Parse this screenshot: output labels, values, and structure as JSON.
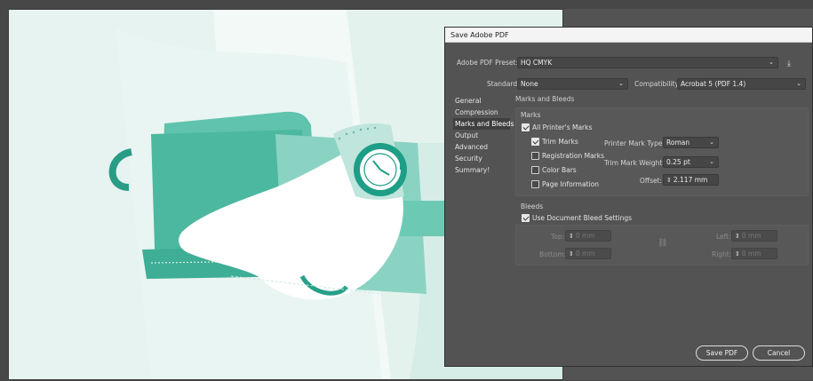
{
  "dialog": {
    "title": "Save Adobe PDF",
    "preset_label": "Adobe PDF Preset:",
    "preset_value": "HQ CMYK",
    "standard_label": "Standard:",
    "standard_value": "None",
    "compat_label": "Compatibility:",
    "compat_value": "Acrobat 5 (PDF 1.4)"
  },
  "sidebar": {
    "items": [
      {
        "label": "General"
      },
      {
        "label": "Compression"
      },
      {
        "label": "Marks and Bleeds"
      },
      {
        "label": "Output"
      },
      {
        "label": "Advanced"
      },
      {
        "label": "Security"
      },
      {
        "label": "Summary!"
      }
    ],
    "selected_index": 2
  },
  "content": {
    "section_title": "Marks and Bleeds",
    "marks": {
      "group_label": "Marks",
      "all_printers_marks": {
        "label": "All Printer's Marks",
        "checked": true
      },
      "trim_marks": {
        "label": "Trim Marks",
        "checked": true
      },
      "registration_marks": {
        "label": "Registration Marks",
        "checked": false
      },
      "color_bars": {
        "label": "Color Bars",
        "checked": false
      },
      "page_information": {
        "label": "Page Information",
        "checked": false
      },
      "printer_mark_type_label": "Printer Mark Type:",
      "printer_mark_type_value": "Roman",
      "trim_mark_weight_label": "Trim Mark Weight:",
      "trim_mark_weight_value": "0.25 pt",
      "offset_label": "Offset:",
      "offset_value": "2.117 mm"
    },
    "bleeds": {
      "group_label": "Bleeds",
      "use_document_bleed": {
        "label": "Use Document Bleed Settings",
        "checked": true
      },
      "top_label": "Top:",
      "top_value": "0 mm",
      "bottom_label": "Bottom:",
      "bottom_value": "0 mm",
      "left_label": "Left:",
      "left_value": "0 mm",
      "right_label": "Right:",
      "right_value": "0 mm"
    }
  },
  "buttons": {
    "save_label": "Save PDF",
    "cancel_label": "Cancel"
  },
  "colors": {
    "accent_teal": "#5fc3ad",
    "dark_teal": "#1e9e86",
    "canvas_bg": "#f2f9f7",
    "dialog_bg": "#535353"
  },
  "icons": {
    "dropdown": "chevron-down-icon",
    "save_preset": "download-icon",
    "stepper": "stepper-icon",
    "link": "chain-link-icon"
  }
}
